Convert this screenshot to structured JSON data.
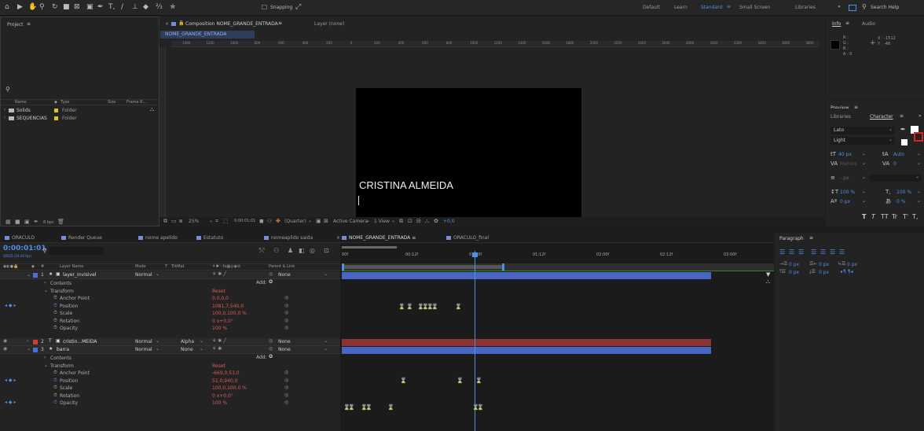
{
  "toolbar": {
    "snapping_label": "Snapping",
    "workspaces": [
      "Default",
      "Learn",
      "Standard",
      "Small Screen",
      "Libraries"
    ],
    "active_workspace": "Standard",
    "search_placeholder": "Search Help"
  },
  "project": {
    "title": "Project",
    "columns": [
      "Name",
      "Type",
      "Size",
      "Frame R..."
    ],
    "items": [
      {
        "name": "Solids",
        "type": "Folder"
      },
      {
        "name": "SEQUENCIAS",
        "type": "Folder"
      }
    ],
    "bpc": "8 bpc"
  },
  "composition": {
    "tab_title": "Composition NOME_GRANDE_ENTRADA",
    "layer_tab": "Layer (none)",
    "breadcrumb": "NOME_GRANDE_ENTRADA",
    "ruler_labels": [
      "1400",
      "1200",
      "1000",
      "800",
      "600",
      "400",
      "200",
      "0",
      "200",
      "400",
      "600",
      "800",
      "1000",
      "1200",
      "1400",
      "1600",
      "1800",
      "2000",
      "2200",
      "2400",
      "2600",
      "2800",
      "3000",
      "3200",
      "3400",
      "3600",
      "3800"
    ],
    "canvas_text": "CRISTINA ALMEIDA",
    "zoom": "25%",
    "timecode": "0:00:01:01",
    "resolution": "(Quarter)",
    "camera": "Active Camera",
    "views": "1 View",
    "exposure": "+0,0"
  },
  "info": {
    "tabs": [
      "Info",
      "Audio"
    ],
    "r": "R :",
    "g": "G :",
    "b": "B :",
    "a": "A : 0",
    "x": "X : -1512",
    "y": "Y : -48"
  },
  "preview": {
    "title": "Preview"
  },
  "character": {
    "tabs": [
      "Libraries",
      "Character"
    ],
    "font": "Lato",
    "style": "Light",
    "size": "40 px",
    "leading": "Auto",
    "kerning": "Metrics",
    "tracking": "0",
    "stroke": "- px",
    "vscale": "100 %",
    "hscale": "100 %",
    "baseline": "0 px",
    "tsume": "0 %",
    "styles": [
      "T",
      "T",
      "TT",
      "Tr",
      "T'",
      "T,"
    ]
  },
  "paragraph": {
    "title": "Paragraph",
    "indent_left": "0 px",
    "indent_right": "0 px",
    "space_before": "0 px",
    "space_after": "0 px",
    "first_line": "0 px"
  },
  "bottom_tabs": [
    "ORACULO",
    "Render Queue",
    "nome apelido",
    "Estatuto",
    "nomeaplido saida",
    "NOME_GRANDE_ENTRADA",
    "ORACULO_final"
  ],
  "active_bottom_tab": "NOME_GRANDE_ENTRADA",
  "timeline": {
    "timecode": "0:00:01:01",
    "frames": "00025 (24.00 fps)",
    "columns": [
      "#",
      "Layer Name",
      "Mode",
      "T",
      "TrkMat",
      "Parent & Link"
    ],
    "ruler": [
      "00f",
      "00:12f",
      "01:00f",
      "01:12f",
      "02:00f",
      "02:12f",
      "03:00f"
    ],
    "add_label": "Add:",
    "reset_label": "Reset",
    "layers": [
      {
        "num": "1",
        "name": "layer_invisivel",
        "mode": "Normal",
        "trkmat": "",
        "parent": "None",
        "color": "#4f6fd8"
      },
      {
        "num": "2",
        "name": "cristin...MEIDA",
        "mode": "Normal",
        "trkmat": "Alpha",
        "parent": "None",
        "color": "#d03a3a"
      },
      {
        "num": "3",
        "name": "barra",
        "mode": "Normal",
        "trkmat": "None",
        "parent": "None",
        "color": "#4f6fd8"
      }
    ],
    "props1": [
      {
        "label": "Contents",
        "value": ""
      },
      {
        "label": "Transform",
        "value": "Reset"
      },
      {
        "label": "Anchor Point",
        "value": "0,0,0,0"
      },
      {
        "label": "Position",
        "value": "1081,7,540,0"
      },
      {
        "label": "Scale",
        "value": "100,0,100,0 %"
      },
      {
        "label": "Rotation",
        "value": "0 x+0,0°"
      },
      {
        "label": "Opacity",
        "value": "100 %"
      }
    ],
    "props3": [
      {
        "label": "Contents",
        "value": ""
      },
      {
        "label": "Transform",
        "value": "Reset"
      },
      {
        "label": "Anchor Point",
        "value": "-669,0,53,0"
      },
      {
        "label": "Position",
        "value": "51,0,940,0"
      },
      {
        "label": "Scale",
        "value": "100,0,100,0 %"
      },
      {
        "label": "Rotation",
        "value": "0 x+0,0°"
      },
      {
        "label": "Opacity",
        "value": "100 %"
      }
    ]
  },
  "colors": {
    "accent": "#4f8fe8",
    "layer_blue": "#4f6fd8",
    "layer_red": "#8a3434",
    "work_area": "#2b8a2b",
    "playhead": "#4f8fe8"
  }
}
